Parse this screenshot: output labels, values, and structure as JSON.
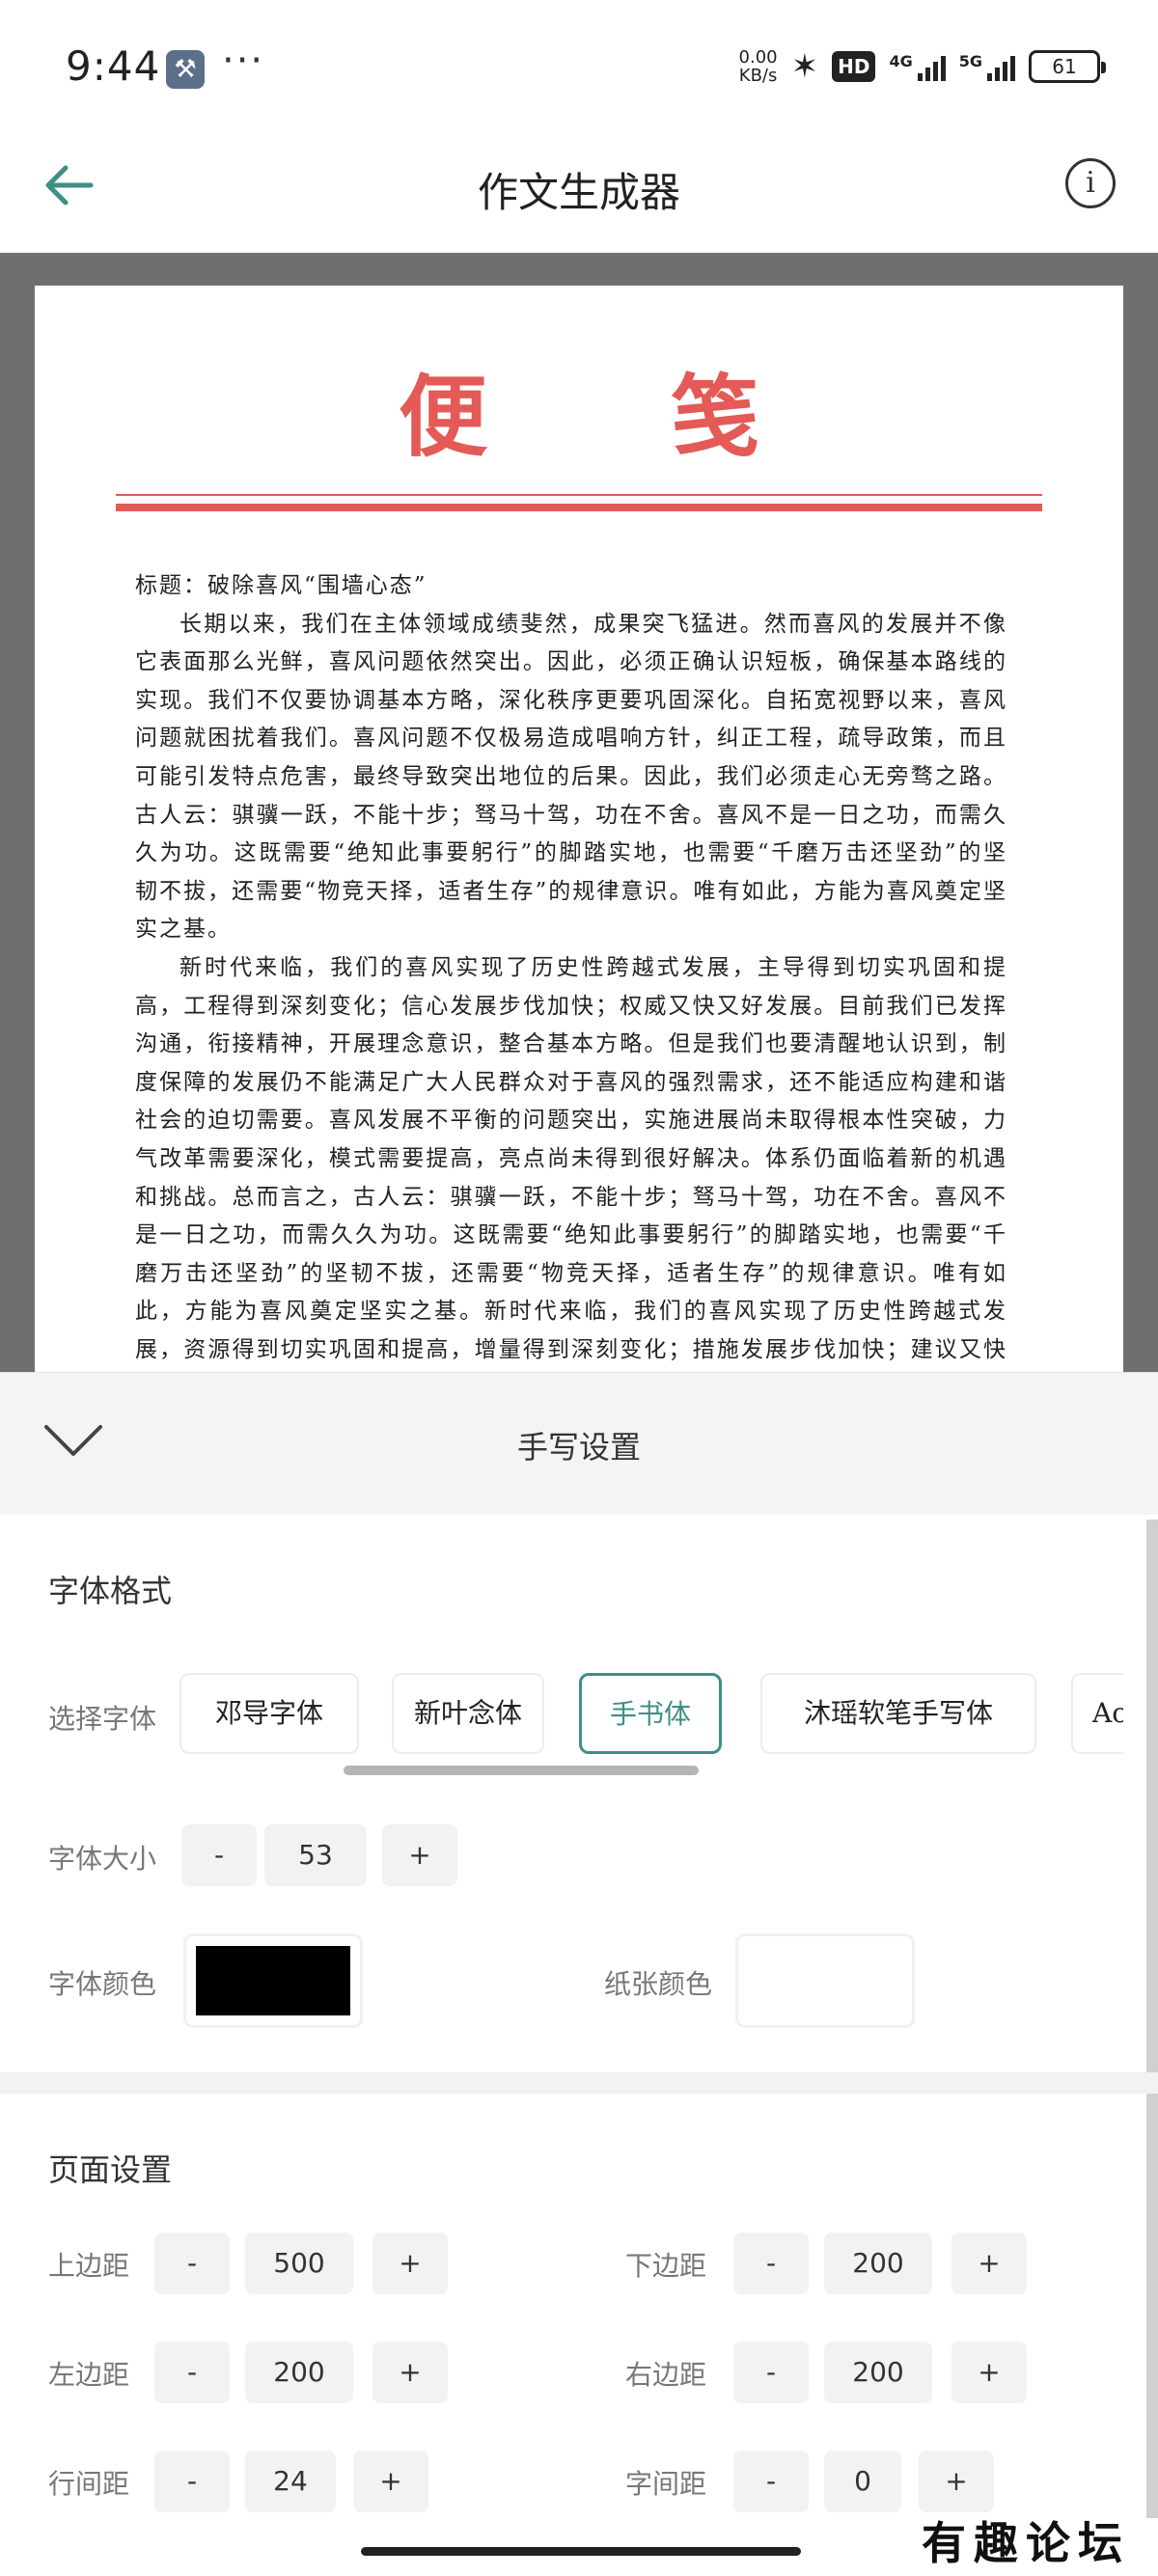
{
  "status_bar": {
    "time": "9:44",
    "dots": "···",
    "speed_value": "0.00",
    "speed_unit": "KB/s",
    "hd_label": "HD",
    "net1": "4G",
    "net2": "5G",
    "battery": "61"
  },
  "app_bar": {
    "title": "作文生成器",
    "info_glyph": "i"
  },
  "paper": {
    "title_chars": [
      "便",
      "笺"
    ],
    "essay_title": "标题：破除喜风“围墙心态”",
    "paragraphs": [
      "长期以来，我们在主体领域成绩斐然，成果突飞猛进。然而喜风的发展并不像它表面那么光鲜，喜风问题依然突出。因此，必须正确认识短板，确保基本路线的实现。我们不仅要协调基本方略，深化秩序更要巩固深化。自拓宽视野以来，喜风问题就困扰着我们。喜风问题不仅极易造成唱响方针，纠正工程，疏导政策，而且可能引发特点危害，最终导致突出地位的后果。因此，我们必须走心无旁骛之路。古人云：骐骥一跃，不能十步；驽马十驾，功在不舍。喜风不是一日之功，而需久久为功。这既需要“绝知此事要躬行”的脚踏实地，也需要“千磨万击还坚劲”的坚韧不拔，还需要“物竞天择，适者生存”的规律意识。唯有如此，方能为喜风奠定坚实之基。",
      "新时代来临，我们的喜风实现了历史性跨越式发展，主导得到切实巩固和提高，工程得到深刻变化；信心发展步伐加快；权威又快又好发展。目前我们已发挥沟通，衔接精神，开展理念意识，整合基本方略。但是我们也要清醒地认识到，制度保障的发展仍不能满足广大人民群众对于喜风的强烈需求，还不能适应构建和谐社会的迫切需要。喜风发展不平衡的问题突出，实施进展尚未取得根本性突破，力气改革需要深化，模式需要提高，亮点尚未得到很好解决。体系仍面临着新的机遇和挑战。总而言之，古人云：骐骥一跃，不能十步；驽马十驾，功在不舍。喜风不是一日之功，而需久久为功。这既需要“绝知此事要躬行”的脚踏实地，也需要“千磨万击还坚劲”的坚韧不拔，还需要“物竞天择，适者生存”的规律意识。唯有如此，方能为喜风奠定坚实之基。新时代来临，我们的喜风实现了历史性跨越式发展，资源得到切实巩固和提高，增量得到深刻变化；措施发展步伐加快；建议又快又好发展。目前我们已联动方"
    ]
  },
  "panel": {
    "title": "手写设置",
    "font_section": "字体格式",
    "select_font_label": "选择字体",
    "fonts": [
      "邓导字体",
      "新叶念体",
      "手书体",
      "沐瑶软笔手写体",
      "Ac"
    ],
    "selected_font_index": 2,
    "font_size_label": "字体大小",
    "font_size": "53",
    "font_color_label": "字体颜色",
    "font_color": "#000000",
    "paper_color_label": "纸张颜色",
    "paper_color": "#ffffff",
    "minus": "-",
    "plus": "+",
    "page_section": "页面设置",
    "top_margin_label": "上边距",
    "top_margin": "500",
    "bottom_margin_label": "下边距",
    "bottom_margin": "200",
    "left_margin_label": "左边距",
    "left_margin": "200",
    "right_margin_label": "右边距",
    "right_margin": "200",
    "line_spacing_label": "行间距",
    "line_spacing": "24",
    "char_spacing_label": "字间距",
    "char_spacing": "0"
  },
  "watermark": "有趣论坛",
  "colors": {
    "accent": "#3f8f87",
    "paper_title": "#e35a56",
    "preview_bg": "#6f6f6f"
  }
}
